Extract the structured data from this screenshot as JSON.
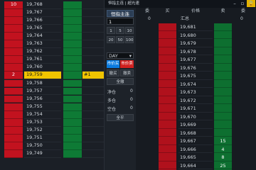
{
  "left_ladder": {
    "rows": [
      {
        "bid": "10",
        "price": "19,768",
        "extra": ""
      },
      {
        "bid": "",
        "price": "19,767",
        "extra": ""
      },
      {
        "bid": "",
        "price": "19,766",
        "extra": ""
      },
      {
        "bid": "",
        "price": "19,765",
        "extra": ""
      },
      {
        "bid": "",
        "price": "19,764",
        "extra": ""
      },
      {
        "bid": "",
        "price": "19,763",
        "extra": ""
      },
      {
        "bid": "",
        "price": "19,762",
        "extra": ""
      },
      {
        "bid": "",
        "price": "19,761",
        "extra": ""
      },
      {
        "bid": "",
        "price": "19,760",
        "extra": ""
      },
      {
        "bid": "2",
        "price": "19,759",
        "extra": "#1",
        "highlight": true
      },
      {
        "bid": "",
        "price": "19,758",
        "extra": ""
      },
      {
        "bid": "",
        "price": "19,757",
        "extra": ""
      },
      {
        "bid": "",
        "price": "19,756",
        "extra": ""
      },
      {
        "bid": "",
        "price": "19,755",
        "extra": ""
      },
      {
        "bid": "",
        "price": "19,754",
        "extra": ""
      },
      {
        "bid": "",
        "price": "19,753",
        "extra": ""
      },
      {
        "bid": "",
        "price": "19,752",
        "extra": ""
      },
      {
        "bid": "",
        "price": "19,751",
        "extra": ""
      },
      {
        "bid": "",
        "price": "19,750",
        "extra": ""
      },
      {
        "bid": "",
        "price": "19,749",
        "extra": ""
      }
    ]
  },
  "window": {
    "title": "恒指主连 | 超光速",
    "icons": {
      "min": "minimize-icon",
      "max": "maximize-icon",
      "lock": "lock-icon"
    }
  },
  "panel": {
    "product": "恒指主连",
    "qty": "1",
    "qty_buttons": [
      "1",
      "5",
      "10",
      "20",
      "50",
      "100"
    ],
    "tif": "DAY",
    "market_buy": "市价买",
    "market_sell": "市价卖",
    "cancel_buy": "撤买",
    "cancel_sell": "撤卖",
    "cancel_all": "全撤",
    "net_label": "净仓",
    "net_value": "0",
    "long_label": "多仓",
    "long_value": "0",
    "short_label": "空仓",
    "short_value": "0",
    "flatten": "全平"
  },
  "grid": {
    "headers": {
      "c1": "委",
      "c2": "买",
      "c3": "价格",
      "c4": "卖",
      "c5": "委"
    },
    "summary": {
      "c1": "0",
      "c3": "汇总",
      "c5": "0"
    },
    "rows": [
      {
        "price": "19,681",
        "ask": ""
      },
      {
        "price": "19,680",
        "ask": ""
      },
      {
        "price": "19,679",
        "ask": ""
      },
      {
        "price": "19,678",
        "ask": ""
      },
      {
        "price": "19,677",
        "ask": ""
      },
      {
        "price": "19,676",
        "ask": ""
      },
      {
        "price": "19,675",
        "ask": ""
      },
      {
        "price": "19,674",
        "ask": ""
      },
      {
        "price": "19,673",
        "ask": ""
      },
      {
        "price": "19,672",
        "ask": ""
      },
      {
        "price": "19,671",
        "ask": ""
      },
      {
        "price": "19,670",
        "ask": ""
      },
      {
        "price": "19,669",
        "ask": ""
      },
      {
        "price": "19,668",
        "ask": ""
      },
      {
        "price": "19,667",
        "ask": "15"
      },
      {
        "price": "19,666",
        "ask": "4"
      },
      {
        "price": "19,665",
        "ask": "8"
      },
      {
        "price": "19,664",
        "ask": "25"
      }
    ]
  },
  "colors": {
    "bid": "#c2121f",
    "ask": "#0e7a35",
    "highlight": "#f0c400",
    "market_buy": "#0a7be0",
    "market_sell": "#d0201f"
  }
}
